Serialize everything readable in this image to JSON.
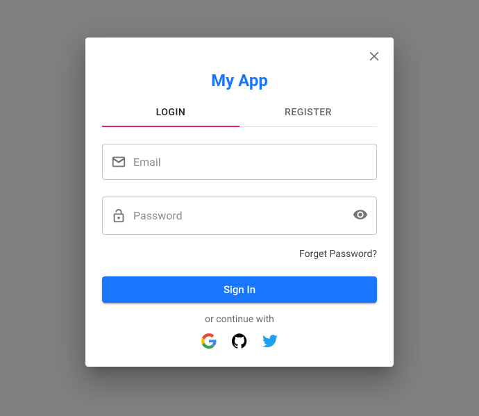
{
  "app": {
    "title": "My App"
  },
  "tabs": {
    "login": "Login",
    "register": "Register",
    "active": "login"
  },
  "fields": {
    "email": {
      "placeholder": "Email",
      "value": ""
    },
    "password": {
      "placeholder": "Password",
      "value": ""
    }
  },
  "actions": {
    "forgot": "Forget Password?",
    "submit": "Sign In",
    "continue": "or continue with"
  },
  "social": {
    "google": "google",
    "github": "github",
    "twitter": "twitter"
  },
  "colors": {
    "primary": "#1976ff",
    "secondary": "#e91e63"
  }
}
